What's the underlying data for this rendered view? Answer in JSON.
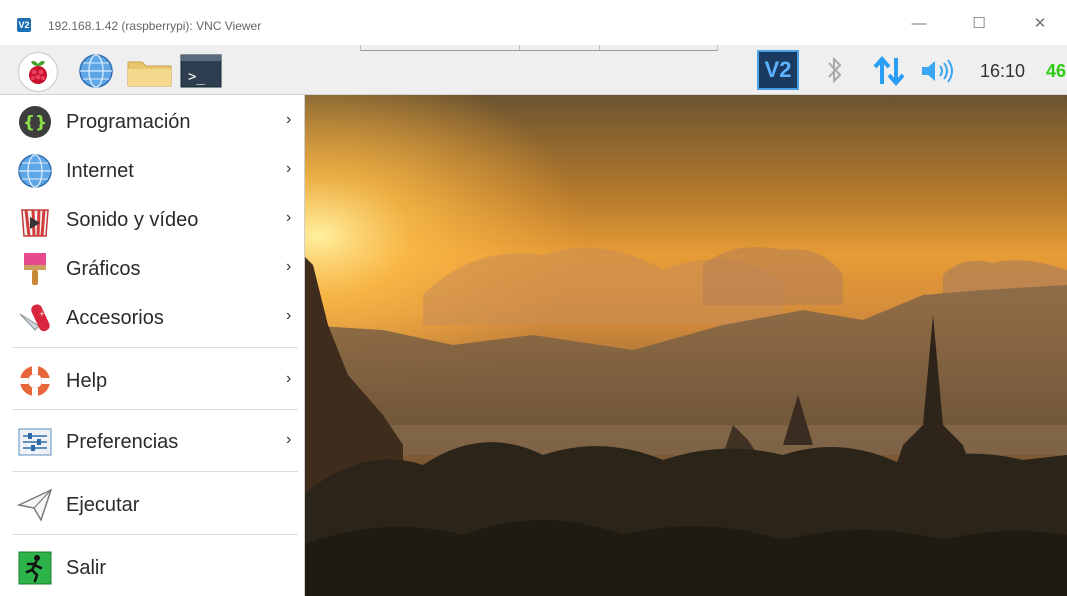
{
  "window": {
    "title": "192.168.1.42 (raspberrypi): VNC Viewer",
    "app_icon_text": "V2",
    "controls": {
      "minimize": "—",
      "maximize": "☐",
      "close": "✕"
    }
  },
  "panel": {
    "launchers": [
      "raspberry-menu-icon",
      "web-browser-globe-icon",
      "file-manager-folder-icon",
      "terminal-icon"
    ],
    "terminal_glyph": ">_",
    "vnc_tray_text": "V2",
    "tray_icons": [
      "vnc-server-icon",
      "bluetooth-icon",
      "network-updown-icon",
      "volume-icon"
    ],
    "clock": "16:10",
    "cpu_usage": "46"
  },
  "menu": {
    "items": [
      {
        "label": "Programación",
        "icon": "code-brackets-icon",
        "submenu": true
      },
      {
        "label": "Internet",
        "icon": "globe-icon",
        "submenu": true
      },
      {
        "label": "Sonido y vídeo",
        "icon": "multimedia-icon",
        "submenu": true
      },
      {
        "label": "Gráficos",
        "icon": "paintbrush-icon",
        "submenu": true
      },
      {
        "label": "Accesorios",
        "icon": "swiss-knife-icon",
        "submenu": true
      },
      {
        "label": "Help",
        "icon": "lifebuoy-icon",
        "submenu": true
      },
      {
        "label": "Preferencias",
        "icon": "settings-sliders-icon",
        "submenu": true
      },
      {
        "label": "Ejecutar",
        "icon": "paper-plane-icon",
        "submenu": false
      },
      {
        "label": "Salir",
        "icon": "exit-running-man-icon",
        "submenu": false
      }
    ],
    "arrow": "›"
  },
  "colors": {
    "panel_bg": "#efefef",
    "vnc_blue": "#1a3a62",
    "cpu_green": "#2ecc12",
    "volume_blue": "#2a9df4"
  }
}
